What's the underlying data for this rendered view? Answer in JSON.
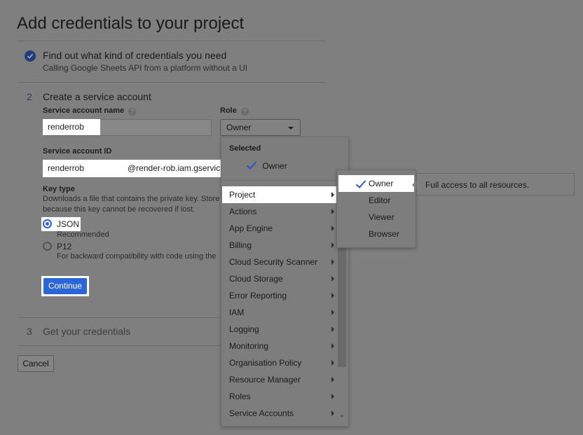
{
  "page": {
    "title": "Add credentials to your project"
  },
  "steps": [
    {
      "number": "",
      "title": "Find out what kind of credentials you need",
      "subtitle": "Calling Google Sheets API from a platform without a UI"
    },
    {
      "number": "2",
      "title": "Create a service account"
    },
    {
      "number": "3",
      "title": "Get your credentials"
    }
  ],
  "form": {
    "service_account_name_label": "Service account name",
    "service_account_name_value": "renderrob",
    "role_label": "Role",
    "role_value": "Owner",
    "service_account_id_label": "Service account ID",
    "service_account_id_value": "renderrob",
    "service_account_id_domain": "@render-rob.iam.gservic",
    "key_type_label": "Key type",
    "key_type_desc_1": "Downloads a file that contains the private key. Store",
    "key_type_desc_2": "because this key cannot be recovered if lost.",
    "json_label": "JSON",
    "json_sub": "Recommended",
    "p12_label": "P12",
    "p12_sub": "For backward compatibility with code using the",
    "continue_label": "Continue",
    "cancel_label": "Cancel",
    "help_glyph": "?"
  },
  "role_menu": {
    "selected_heading": "Selected",
    "selected_value": "Owner",
    "items": [
      "Project",
      "Actions",
      "App Engine",
      "Billing",
      "Cloud Security Scanner",
      "Cloud Storage",
      "Error Reporting",
      "IAM",
      "Logging",
      "Monitoring",
      "Organisation Policy",
      "Resource Manager",
      "Roles",
      "Service Accounts"
    ],
    "highlighted_item": "Project",
    "scroll_down_glyph": "⌄"
  },
  "submenu": {
    "items": [
      "Owner",
      "Editor",
      "Viewer",
      "Browser"
    ],
    "checked": "Owner"
  },
  "tooltip": {
    "text": "Full access to all resources."
  },
  "colors": {
    "overlay_gray": "#7f7f7f",
    "accent_blue": "#2a66d8",
    "check_blue": "#1f3f7a",
    "highlight_white": "#ffffff"
  },
  "icons": {
    "step_done": "check-circle-icon",
    "help": "help-circle-icon",
    "dropdown": "caret-down-icon",
    "submenu_arrow": "chevron-right-icon",
    "selected": "check-icon"
  }
}
